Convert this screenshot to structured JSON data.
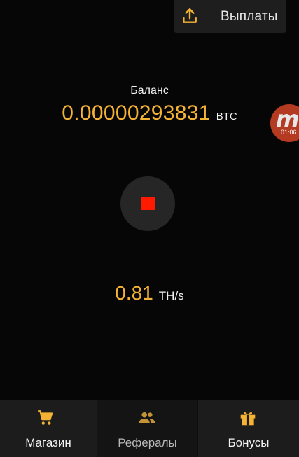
{
  "header": {
    "payout_label": "Выплаты",
    "payout_icon": "upload-icon"
  },
  "balance": {
    "label": "Баланс",
    "value": "0.00000293831",
    "unit": "BTC"
  },
  "floating_bubble": {
    "letter": "m",
    "time": "01:06"
  },
  "mining": {
    "control_icon": "stop-icon",
    "hashrate_value": "0.81",
    "hashrate_unit": "TH/s"
  },
  "nav": {
    "items": [
      {
        "label": "Магазин",
        "icon": "cart-icon"
      },
      {
        "label": "Рефералы",
        "icon": "people-icon"
      },
      {
        "label": "Бонусы",
        "icon": "gift-icon"
      }
    ]
  },
  "colors": {
    "accent": "#f5b335",
    "stop": "#ff1a00",
    "background": "#060606",
    "nav_background": "#1c1c1c"
  }
}
